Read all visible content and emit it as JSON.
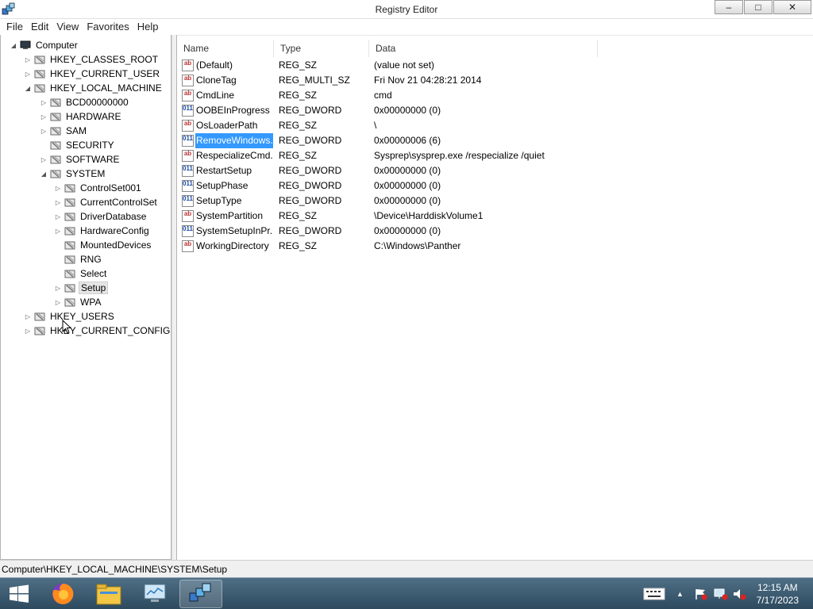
{
  "window": {
    "title": "Registry Editor"
  },
  "window_buttons": {
    "minimize": "–",
    "maximize": "□",
    "close": "✕"
  },
  "menu": [
    "File",
    "Edit",
    "View",
    "Favorites",
    "Help"
  ],
  "tree": [
    {
      "label": "Computer",
      "level": 0,
      "expander": "◢",
      "kind": "computer"
    },
    {
      "label": "HKEY_CLASSES_ROOT",
      "level": 1,
      "expander": "▷"
    },
    {
      "label": "HKEY_CURRENT_USER",
      "level": 1,
      "expander": "▷"
    },
    {
      "label": "HKEY_LOCAL_MACHINE",
      "level": 1,
      "expander": "◢"
    },
    {
      "label": "BCD00000000",
      "level": 2,
      "expander": "▷"
    },
    {
      "label": "HARDWARE",
      "level": 2,
      "expander": "▷"
    },
    {
      "label": "SAM",
      "level": 2,
      "expander": "▷"
    },
    {
      "label": "SECURITY",
      "level": 2,
      "expander": ""
    },
    {
      "label": "SOFTWARE",
      "level": 2,
      "expander": "▷"
    },
    {
      "label": "SYSTEM",
      "level": 2,
      "expander": "◢"
    },
    {
      "label": "ControlSet001",
      "level": 3,
      "expander": "▷"
    },
    {
      "label": "CurrentControlSet",
      "level": 3,
      "expander": "▷"
    },
    {
      "label": "DriverDatabase",
      "level": 3,
      "expander": "▷"
    },
    {
      "label": "HardwareConfig",
      "level": 3,
      "expander": "▷"
    },
    {
      "label": "MountedDevices",
      "level": 3,
      "expander": ""
    },
    {
      "label": "RNG",
      "level": 3,
      "expander": ""
    },
    {
      "label": "Select",
      "level": 3,
      "expander": ""
    },
    {
      "label": "Setup",
      "level": 3,
      "expander": "▷",
      "selected": true
    },
    {
      "label": "WPA",
      "level": 3,
      "expander": "▷"
    },
    {
      "label": "HKEY_USERS",
      "level": 1,
      "expander": "▷"
    },
    {
      "label": "HKEY_CURRENT_CONFIG",
      "level": 1,
      "expander": "▷"
    }
  ],
  "columns": [
    "Name",
    "Type",
    "Data"
  ],
  "values": [
    {
      "name": "(Default)",
      "type": "REG_SZ",
      "data": "(value not set)",
      "icon": "ab"
    },
    {
      "name": "CloneTag",
      "type": "REG_MULTI_SZ",
      "data": "Fri Nov 21 04:28:21 2014",
      "icon": "ab"
    },
    {
      "name": "CmdLine",
      "type": "REG_SZ",
      "data": "cmd",
      "icon": "ab"
    },
    {
      "name": "OOBEInProgress",
      "type": "REG_DWORD",
      "data": "0x00000000 (0)",
      "icon": "bin"
    },
    {
      "name": "OsLoaderPath",
      "type": "REG_SZ",
      "data": "\\",
      "icon": "ab"
    },
    {
      "name": "RemoveWindows...",
      "type": "REG_DWORD",
      "data": "0x00000006 (6)",
      "icon": "bin",
      "selected": true
    },
    {
      "name": "RespecializeCmd...",
      "type": "REG_SZ",
      "data": "Sysprep\\sysprep.exe /respecialize /quiet",
      "icon": "ab"
    },
    {
      "name": "RestartSetup",
      "type": "REG_DWORD",
      "data": "0x00000000 (0)",
      "icon": "bin"
    },
    {
      "name": "SetupPhase",
      "type": "REG_DWORD",
      "data": "0x00000000 (0)",
      "icon": "bin"
    },
    {
      "name": "SetupType",
      "type": "REG_DWORD",
      "data": "0x00000000 (0)",
      "icon": "bin"
    },
    {
      "name": "SystemPartition",
      "type": "REG_SZ",
      "data": "\\Device\\HarddiskVolume1",
      "icon": "ab"
    },
    {
      "name": "SystemSetupInPr...",
      "type": "REG_DWORD",
      "data": "0x00000000 (0)",
      "icon": "bin"
    },
    {
      "name": "WorkingDirectory",
      "type": "REG_SZ",
      "data": "C:\\Windows\\Panther",
      "icon": "ab"
    }
  ],
  "icon_text": {
    "ab": "ab",
    "bin": "011"
  },
  "status": {
    "path": "Computer\\HKEY_LOCAL_MACHINE\\SYSTEM\\Setup"
  },
  "taskbar": {
    "apps": [
      "firefox-icon",
      "file-explorer-icon",
      "remote-desktop-icon",
      "registry-editor-icon"
    ],
    "tray_arrow": "▲"
  },
  "clock": {
    "time": "12:15 AM",
    "date": "7/17/2023"
  }
}
